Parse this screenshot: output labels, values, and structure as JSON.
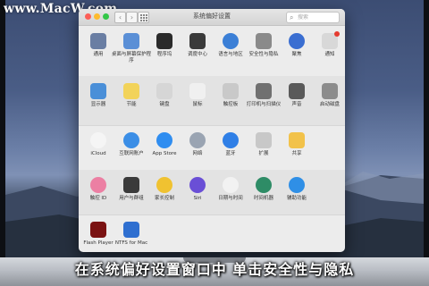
{
  "watermark": "www.MacW.com",
  "window": {
    "title": "系统偏好设置",
    "search_placeholder": "搜索"
  },
  "rows": [
    [
      {
        "label": "通用",
        "icon": "general-icon",
        "color": "#6a7ea3"
      },
      {
        "label": "桌面与屏幕保护程序",
        "icon": "desktop-screensaver-icon",
        "color": "#5a8fd6"
      },
      {
        "label": "程序坞",
        "icon": "dock-icon",
        "color": "#2b2b2b"
      },
      {
        "label": "调度中心",
        "icon": "mission-control-icon",
        "color": "#3a3a3a"
      },
      {
        "label": "语言与地区",
        "icon": "language-region-icon",
        "color": "#3b7fd6"
      },
      {
        "label": "安全性与隐私",
        "icon": "security-privacy-icon",
        "color": "#8a8a8a"
      },
      {
        "label": "聚焦",
        "icon": "spotlight-icon",
        "color": "#3a6ed1"
      },
      {
        "label": "通知",
        "icon": "notifications-icon",
        "color": "#d8d8d8",
        "badge": true
      }
    ],
    [
      {
        "label": "显示器",
        "icon": "displays-icon",
        "color": "#4a8fd8"
      },
      {
        "label": "节能",
        "icon": "energy-saver-icon",
        "color": "#f2d35a"
      },
      {
        "label": "键盘",
        "icon": "keyboard-icon",
        "color": "#d6d6d6"
      },
      {
        "label": "鼠标",
        "icon": "mouse-icon",
        "color": "#f0f0f0"
      },
      {
        "label": "触控板",
        "icon": "trackpad-icon",
        "color": "#c9c9c9"
      },
      {
        "label": "打印机与扫描仪",
        "icon": "printer-icon",
        "color": "#707070"
      },
      {
        "label": "声音",
        "icon": "sound-icon",
        "color": "#5a5a5a"
      },
      {
        "label": "启动磁盘",
        "icon": "startup-disk-icon",
        "color": "#8c8c8c"
      }
    ],
    [
      {
        "label": "iCloud",
        "icon": "icloud-icon",
        "color": "#f5f5f5"
      },
      {
        "label": "互联网账户",
        "icon": "internet-accounts-icon",
        "color": "#3b8ee6"
      },
      {
        "label": "App Store",
        "icon": "app-store-icon",
        "color": "#2f8df0"
      },
      {
        "label": "网络",
        "icon": "network-icon",
        "color": "#9aa4b2"
      },
      {
        "label": "蓝牙",
        "icon": "bluetooth-icon",
        "color": "#2f7fe6"
      },
      {
        "label": "扩展",
        "icon": "extensions-icon",
        "color": "#c8c8c8"
      },
      {
        "label": "共享",
        "icon": "sharing-icon",
        "color": "#f2c24a"
      }
    ],
    [
      {
        "label": "触控 ID",
        "icon": "touch-id-icon",
        "color": "#ec7fa3"
      },
      {
        "label": "用户与群组",
        "icon": "users-groups-icon",
        "color": "#3a3a3a"
      },
      {
        "label": "家长控制",
        "icon": "parental-controls-icon",
        "color": "#f0c231"
      },
      {
        "label": "Siri",
        "icon": "siri-icon",
        "color": "#6a4fd6"
      },
      {
        "label": "日期与时间",
        "icon": "date-time-icon",
        "color": "#f2f2f2"
      },
      {
        "label": "时间机器",
        "icon": "time-machine-icon",
        "color": "#2e8c66"
      },
      {
        "label": "辅助功能",
        "icon": "accessibility-icon",
        "color": "#2f8fe6"
      }
    ],
    [
      {
        "label": "Flash Player",
        "icon": "flash-player-icon",
        "color": "#7a1212"
      },
      {
        "label": "NTFS for Mac",
        "icon": "ntfs-for-mac-icon",
        "color": "#2f6fd0"
      }
    ]
  ],
  "caption": "在系统偏好设置窗口中 单击安全性与隐私"
}
